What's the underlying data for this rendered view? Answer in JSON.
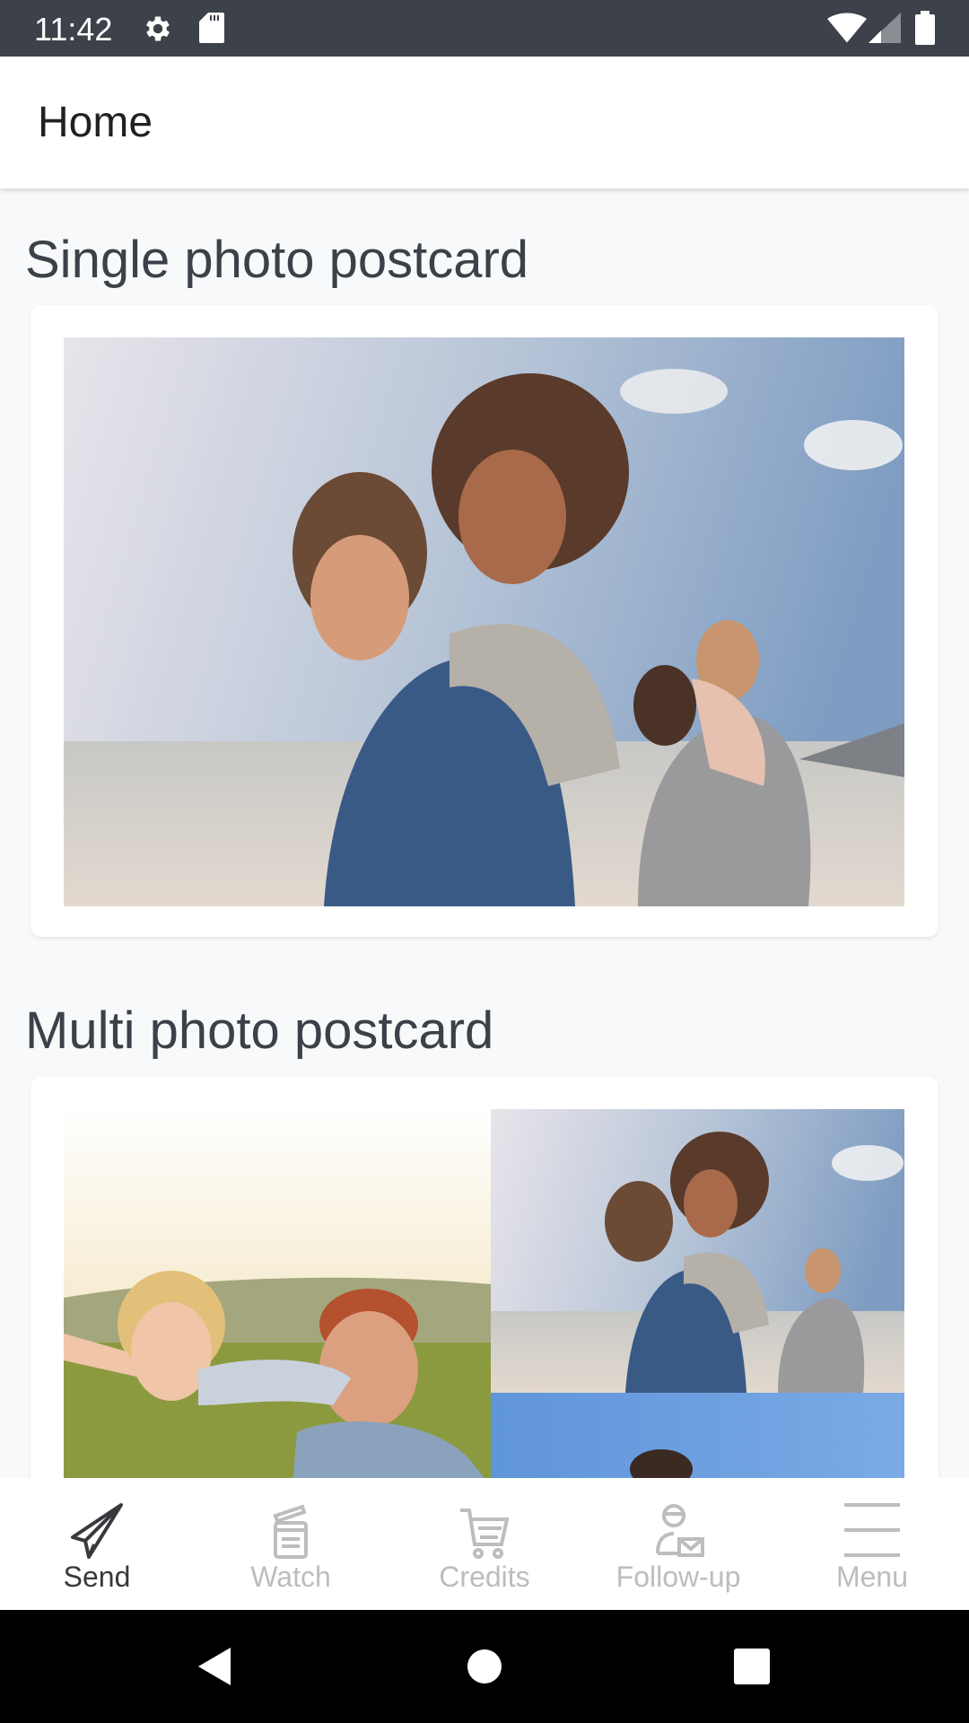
{
  "status_bar": {
    "time": "11:42",
    "left_icons": [
      "gear-icon",
      "sd-card-icon"
    ],
    "right_icons": [
      "wifi-icon",
      "cell-signal-icon",
      "battery-icon"
    ]
  },
  "app_bar": {
    "title": "Home"
  },
  "sections": [
    {
      "title": "Single photo postcard",
      "image_description": "Two couples laughing on a beach, men giving piggyback rides"
    },
    {
      "title": "Multi photo postcard",
      "images": [
        "Girl with arms outstretched playing airplane with smiling father in a field",
        "Two couples laughing on a beach, men giving piggyback rides",
        "Person under a blue sky"
      ]
    }
  ],
  "bottom_nav": {
    "items": [
      {
        "label": "Send",
        "icon": "paper-plane-icon",
        "active": true
      },
      {
        "label": "Watch",
        "icon": "clapperboard-icon",
        "active": false
      },
      {
        "label": "Credits",
        "icon": "shopping-cart-icon",
        "active": false
      },
      {
        "label": "Follow-up",
        "icon": "person-mail-icon",
        "active": false
      },
      {
        "label": "Menu",
        "icon": "hamburger-menu-icon",
        "active": false
      }
    ]
  },
  "colors": {
    "status_bar_bg": "#3c414a",
    "nav_active": "#37393d",
    "nav_inactive": "#bdbdbd",
    "page_bg": "#f8f9fa"
  }
}
